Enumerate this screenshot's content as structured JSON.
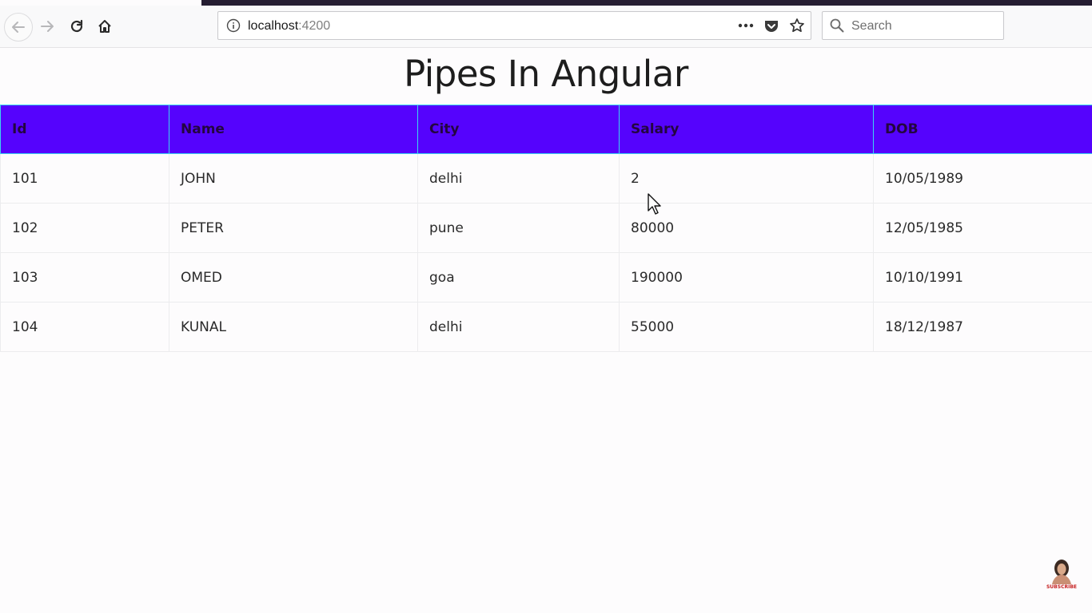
{
  "browser": {
    "url_host": "localhost",
    "url_port": ":4200",
    "search_placeholder": "Search"
  },
  "page": {
    "title": "Pipes In Angular"
  },
  "table": {
    "headers": [
      "Id",
      "Name",
      "City",
      "Salary",
      "DOB"
    ],
    "rows": [
      [
        "101",
        "JOHN",
        "delhi",
        "2",
        "10/05/1989"
      ],
      [
        "102",
        "PETER",
        "pune",
        "80000",
        "12/05/1985"
      ],
      [
        "103",
        "OMED",
        "goa",
        "190000",
        "10/10/1991"
      ],
      [
        "104",
        "KUNAL",
        "delhi",
        "55000",
        "18/12/1987"
      ]
    ]
  },
  "overlay": {
    "subscribe_label": "SUBSCRIBE"
  },
  "colors": {
    "header_bg": "#5503fd",
    "header_border": "#3ad7f0",
    "header_text": "#240640"
  }
}
